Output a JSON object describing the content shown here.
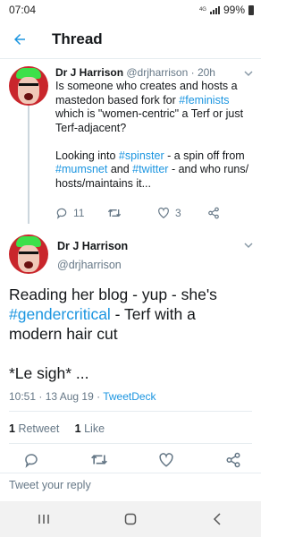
{
  "status_bar": {
    "time": "07:04",
    "network": "4G",
    "battery": "99%"
  },
  "app_bar": {
    "title": "Thread",
    "back_icon": "arrow-left-icon"
  },
  "colors": {
    "accent": "#1b95e0",
    "text": "#14171a",
    "muted": "#657786",
    "divider": "#e6ecf0"
  },
  "tweet1": {
    "name": "Dr J Harrison",
    "handle": "@drjharrison",
    "separator": "·",
    "time": "20h",
    "line1": "Is someone who creates and hosts a mastedon based fork for ",
    "hashtag1": "#feminists",
    "line2": " which is \"women-centric\" a Terf or just Terf-adjacent?",
    "line3": "Looking into ",
    "hashtag2": "#spinster",
    "line4": " - a spin off from ",
    "hashtag3": "#mumsnet",
    "line5": " and ",
    "hashtag4": "#twitter",
    "line6": " - and who runs/ hosts/maintains it...",
    "replies": "11",
    "likes": "3"
  },
  "tweet2": {
    "name": "Dr J Harrison",
    "handle": "@drjharrison",
    "text1": "Reading her blog - yup - she's ",
    "hashtag": "#gendercritical",
    "text2": " - Terf with a modern hair cut",
    "text3": "*Le sigh* ...",
    "timestamp": "10:51 · 13 Aug 19 · ",
    "client": "TweetDeck",
    "retweet_count": "1",
    "retweet_label": "Retweet",
    "like_count": "1",
    "like_label": "Like"
  },
  "reply": {
    "placeholder": "Tweet your reply"
  }
}
